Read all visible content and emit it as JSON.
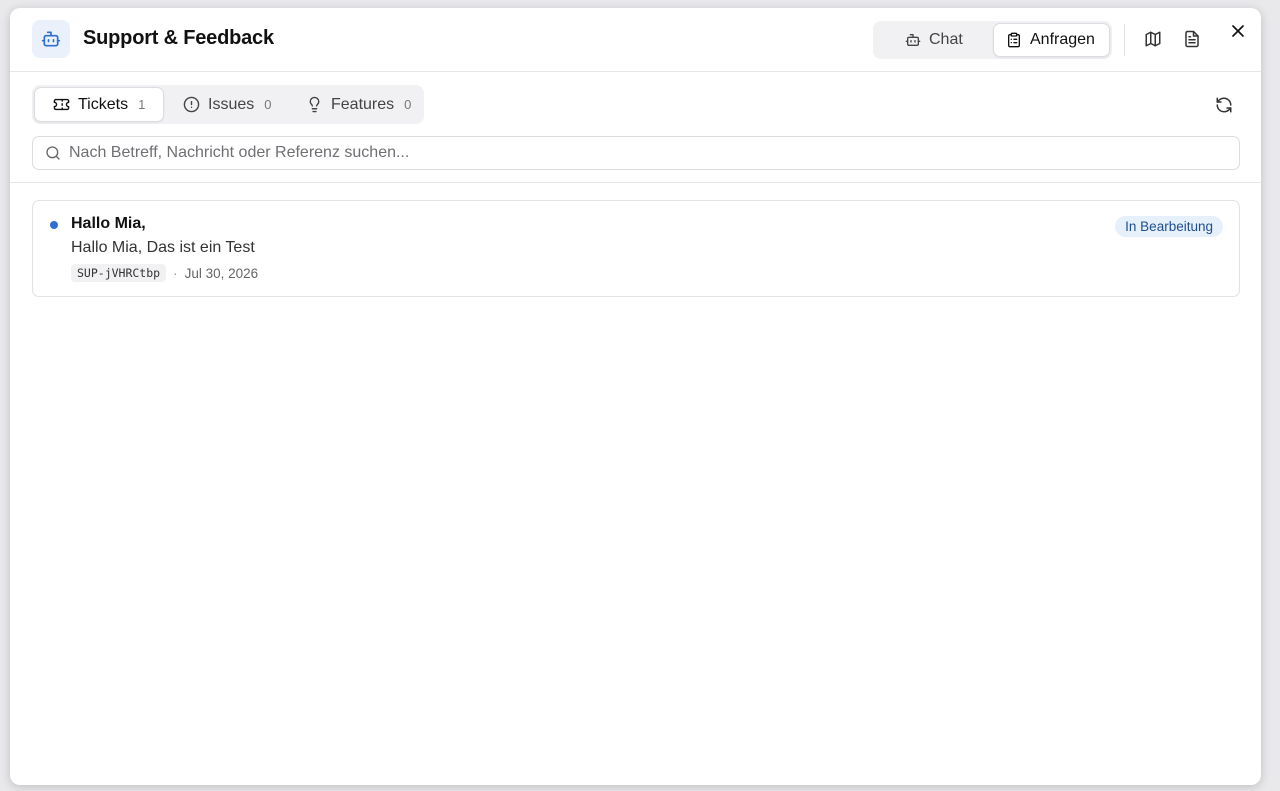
{
  "header": {
    "title": "Support & Feedback",
    "mode_tabs": [
      {
        "label": "Chat",
        "icon": "bot-icon",
        "active": false
      },
      {
        "label": "Anfragen",
        "icon": "clipboard-icon",
        "active": true
      }
    ]
  },
  "tabs": [
    {
      "label": "Tickets",
      "count": "1",
      "icon": "ticket-icon",
      "active": true
    },
    {
      "label": "Issues",
      "count": "0",
      "icon": "alert-circle-icon",
      "active": false
    },
    {
      "label": "Features",
      "count": "0",
      "icon": "lightbulb-icon",
      "active": false
    }
  ],
  "search": {
    "placeholder": "Nach Betreff, Nachricht oder Referenz suchen...",
    "value": ""
  },
  "tickets": [
    {
      "subject": "Hallo Mia,",
      "preview": "Hallo Mia, Das ist ein Test",
      "reference": "SUP-jVHRCtbp",
      "separator": "·",
      "date": "Jul 30, 2026",
      "status": "In Bearbeitung",
      "unread": true
    }
  ],
  "colors": {
    "accent": "#2f6fd0",
    "badge_bg": "#e6f0fb",
    "badge_text": "#1e4f8f"
  }
}
